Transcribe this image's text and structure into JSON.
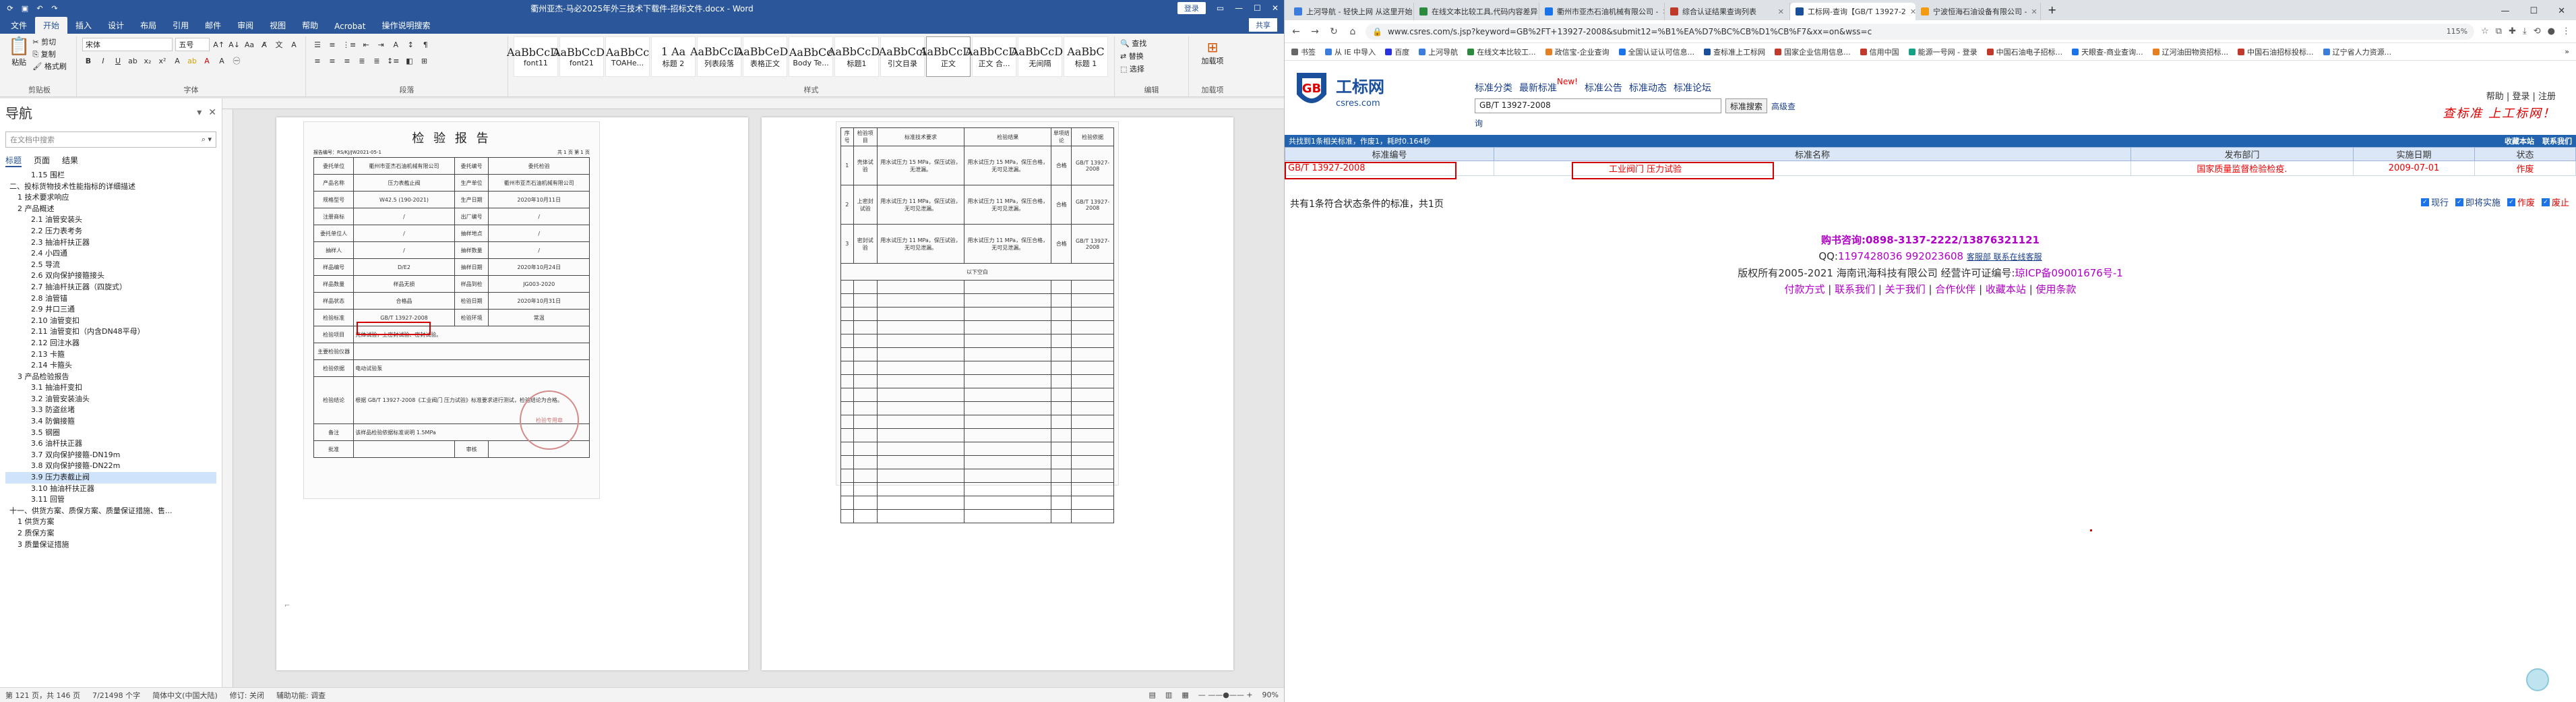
{
  "word": {
    "title": "衢州亚杰-马必2025年外三技术下载件-招标文件.docx - Word",
    "login": "登录",
    "share": "共享",
    "tabs": [
      "文件",
      "开始",
      "插入",
      "设计",
      "布局",
      "引用",
      "邮件",
      "审阅",
      "视图",
      "帮助",
      "Acrobat",
      "操作说明搜索"
    ],
    "active_tab": "开始",
    "ribbon": {
      "clipboard_label": "剪贴板",
      "paste": "粘贴",
      "cut": "剪切",
      "copy": "复制",
      "format_painter": "格式刷",
      "font_name": "宋体",
      "font_size": "五号",
      "font_label": "字体",
      "paragraph_label": "段落",
      "styles_label": "样式",
      "editing_label": "编辑",
      "addins_label": "加载项",
      "find": "查找",
      "replace": "替换",
      "select": "选择",
      "addins": "加载项",
      "styles": [
        {
          "preview": "AaBbCcDc",
          "name": "font11"
        },
        {
          "preview": "AaBbCcDc",
          "name": "font21"
        },
        {
          "preview": "AaBbCc",
          "name": "TOAHe..."
        },
        {
          "preview": "1 Aa",
          "name": "标题 2"
        },
        {
          "preview": "AaBbCcDc",
          "name": "列表段落"
        },
        {
          "preview": "AaBbCeDc",
          "name": "表格正文"
        },
        {
          "preview": "AaBbCc",
          "name": "Body Te..."
        },
        {
          "preview": "AaBbCcDc",
          "name": "标题1"
        },
        {
          "preview": "AaBbCcI",
          "name": "引文目录"
        },
        {
          "preview": "AaBbCcDc",
          "name": "正文"
        },
        {
          "preview": "AaBbCcDc",
          "name": "正文 合..."
        },
        {
          "preview": "AaBbCcDc",
          "name": "无间隔"
        },
        {
          "preview": "AaBbC",
          "name": "标题 1"
        }
      ]
    },
    "nav": {
      "title": "导航",
      "search_placeholder": "在文档中搜索",
      "tabs": [
        "标题",
        "页面",
        "结果"
      ],
      "active_tab": "标题",
      "items": [
        "1.15 围栏",
        "二、投标货物技术性能指标的详细描述",
        "1 技术要求响应",
        "2 产品概述",
        "2.1 油管安装头",
        "2.2 压力表考务",
        "2.3 抽油杆扶正器",
        "2.4 小四通",
        "2.5 导流",
        "2.6 双向保护接箍接头",
        "2.7 抽油杆扶正器（四旋式）",
        "2.8 油管锚",
        "2.9 井口三通",
        "2.10 油管变扣",
        "2.11 油管变扣（内含DN48平母）",
        "2.12 回注水器",
        "2.13 卡箍",
        "2.14 卡箍头",
        "3 产品检验报告",
        "3.1 抽油杆变扣",
        "3.2 油管安装油头",
        "3.3 防盗丝堵",
        "3.4 防偏接箍",
        "3.5 钢圈",
        "3.6 油杆扶正器",
        "3.7 双向保护接箍-DN19m",
        "3.8 双向保护接箍-DN22m",
        "3.9 压力表截止阀",
        "3.10 抽油杆扶正器",
        "3.11 回管",
        "十一、供货方案、质保方案、质量保证措施、售...",
        "1 供货方案",
        "2 质保方案",
        "3 质量保证措施"
      ],
      "highlighted_index": 27
    },
    "report": {
      "title": "检 验 报 告",
      "report_no": "报告编号：RS/KJ/JW2021-05-1",
      "page_no": "共 1 页 第 1 页",
      "rows": [
        [
          "委托单位",
          "衢州市亚杰石油机械有限公司",
          "委托编号",
          "委托检验"
        ],
        [
          "产品名称",
          "压力表截止阀",
          "生产单位",
          "衢州市亚杰石油机械有限公司"
        ],
        [
          "规格型号",
          "W42.5 (190-2021)",
          "生产日期",
          "2020年10月11日"
        ],
        [
          "注册商标",
          "/",
          "出厂编号",
          "/"
        ],
        [
          "委托单位人",
          "/",
          "抽样地点",
          "/"
        ],
        [
          "抽样人",
          "/",
          "抽样数量",
          "/"
        ],
        [
          "样品编号",
          "D/E2",
          "抽样日期",
          "2020年10月24日"
        ],
        [
          "样品数量",
          "样品无损",
          "样品到检",
          "JG003-2020"
        ],
        [
          "样品状态",
          "合格品",
          "检验日期",
          "2020年10月31日"
        ],
        [
          "检验标准",
          "GB/T 13927-2008",
          "检验环境",
          "常温"
        ],
        [
          "检验项目",
          "壳体试验，上密封试验、密封试验。",
          "",
          ""
        ],
        [
          "主要检验仪器",
          "",
          "",
          ""
        ],
        [
          "检验依据",
          "电动试验泵",
          "",
          ""
        ],
        [
          "检验结论",
          "根据 GB/T 13927-2008《工业阀门 压力试验》标准要求进行测试，检验结论为合格。",
          "",
          ""
        ],
        [
          "备注",
          "该样品检验依据标准说明 1.5MPa",
          "",
          ""
        ],
        [
          "批准",
          "",
          "审核",
          ""
        ]
      ],
      "page2_headers": [
        "序号",
        "检验项目",
        "标准技术要求",
        "检验结果",
        "单项结论",
        "检验依据"
      ],
      "page2_rows": [
        [
          "1",
          "壳体试验",
          "用水试压力 15 MPa，保压试验，无泄漏。",
          "用水试压力 15 MPa，保压合格，无可见泄漏。",
          "合格",
          "GB/T 13927-2008"
        ],
        [
          "2",
          "上密封试验",
          "用水试压力 11 MPa，保压试验，无可见泄漏。",
          "用水试压力 11 MPa，保压合格，无可见泄漏。",
          "合格",
          "GB/T 13927-2008"
        ],
        [
          "3",
          "密封试验",
          "用水试压力 11 MPa，保压试验，无可见泄漏。",
          "用水试压力 11 MPa，保压合格，无可见泄漏。",
          "合格",
          "GB/T 13927-2008"
        ]
      ],
      "page2_blank_note": "以下空白",
      "stamp_text": "检验专用章"
    },
    "status": {
      "page": "第 121 页，共 146 页",
      "words": "7/21498 个字",
      "lang": "简体中文(中国大陆)",
      "track": "修订: 关闭",
      "access": "辅助功能: 调查",
      "zoom": "90%"
    }
  },
  "browser": {
    "tabs": [
      {
        "title": "上河导航 - 轻快上网 从这里开始",
        "color": "#3b7ddd"
      },
      {
        "title": "在线文本比较工具,代码内容差异",
        "color": "#2b8a3e"
      },
      {
        "title": "衢州市亚杰石油机械有限公司 -",
        "color": "#1a73e8"
      },
      {
        "title": "综合认证结果查询列表",
        "color": "#c0392b"
      },
      {
        "title": "工标网-查询【GB/T 13927-2",
        "color": "#1a4f9c"
      },
      {
        "title": "宁波恒海石油设备有限公司 -",
        "color": "#f39c12"
      }
    ],
    "active_tab_index": 4,
    "url": "www.csres.com/s.jsp?keyword=GB%2FT+13927-2008&submit12=%B1%EA%D7%BC%CB%D1%CB%F7&xx=on&wss=c",
    "zoom": "115%",
    "bookmarks": [
      {
        "label": "书签",
        "color": "#666"
      },
      {
        "label": "从 IE 中导入",
        "color": "#3b7ddd"
      },
      {
        "label": "百度",
        "color": "#2932e1"
      },
      {
        "label": "上河导航",
        "color": "#3b7ddd"
      },
      {
        "label": "在线文本比较工...",
        "color": "#2b8a3e"
      },
      {
        "label": "政信宝-企业查询",
        "color": "#e67e22"
      },
      {
        "label": "全国认证认可信息...",
        "color": "#1a73e8"
      },
      {
        "label": "查标准上工标网",
        "color": "#1a4f9c"
      },
      {
        "label": "国家企业信用信息...",
        "color": "#c0392b"
      },
      {
        "label": "信用中国",
        "color": "#c0392b"
      },
      {
        "label": "能源一号网 - 登录",
        "color": "#16a085"
      },
      {
        "label": "中国石油电子招标...",
        "color": "#c0392b"
      },
      {
        "label": "天眼查-商业查询...",
        "color": "#1a73e8"
      },
      {
        "label": "辽河油田物资招标...",
        "color": "#e67e22"
      },
      {
        "label": "中国石油招标投标...",
        "color": "#c0392b"
      },
      {
        "label": "辽宁省人力资源...",
        "color": "#3b7ddd"
      }
    ],
    "bookmarks_more": "»",
    "site": {
      "logo_cn": "工标网",
      "logo_en": "csres.com",
      "nav_links": [
        "标准分类",
        "最新标准",
        "标准公告",
        "标准动态",
        "标准论坛"
      ],
      "new_badge": "New!",
      "search_value": "GB/T 13927-2008",
      "search_button": "标准搜索",
      "advanced": "高级查",
      "advanced_line2": "询",
      "top_right": "帮助 | 登录 | 注册",
      "slogan": "查标准 上工标网！",
      "bar_left": "共找到1条相关标准，作废1，耗时0.164秒",
      "bar_right": [
        "收藏本站",
        "联系我们"
      ],
      "table_headers": [
        "标准编号",
        "标准名称",
        "发布部门",
        "实施日期",
        "状态"
      ],
      "table_rows": [
        [
          "GB/T 13927-2008",
          "工业阀门 压力试验",
          "国家质量监督检验检疫.",
          "2009-07-01",
          "作废"
        ]
      ],
      "count_line": "共有1条符合状态条件的标准，共1页",
      "filters": [
        {
          "label": "现行",
          "class": "blue"
        },
        {
          "label": "即将实施",
          "class": "blue"
        },
        {
          "label": "作废",
          "class": "red"
        },
        {
          "label": "废止",
          "class": "red"
        }
      ],
      "footer": {
        "buy": "购书咨询:0898-3137-2222/13876321121",
        "qq_label": "QQ:",
        "qq": "1197428036 992023608",
        "qq_link": "客服部  联系在线客服",
        "copy": "版权所有2005-2021 海南讯海科技有限公司 经营许可证编号:",
        "icp": "琼ICP备09001676号-1",
        "links": [
          "付款方式",
          "联系我们",
          "关于我们",
          "合作伙伴",
          "收藏本站",
          "使用条款"
        ]
      }
    }
  }
}
